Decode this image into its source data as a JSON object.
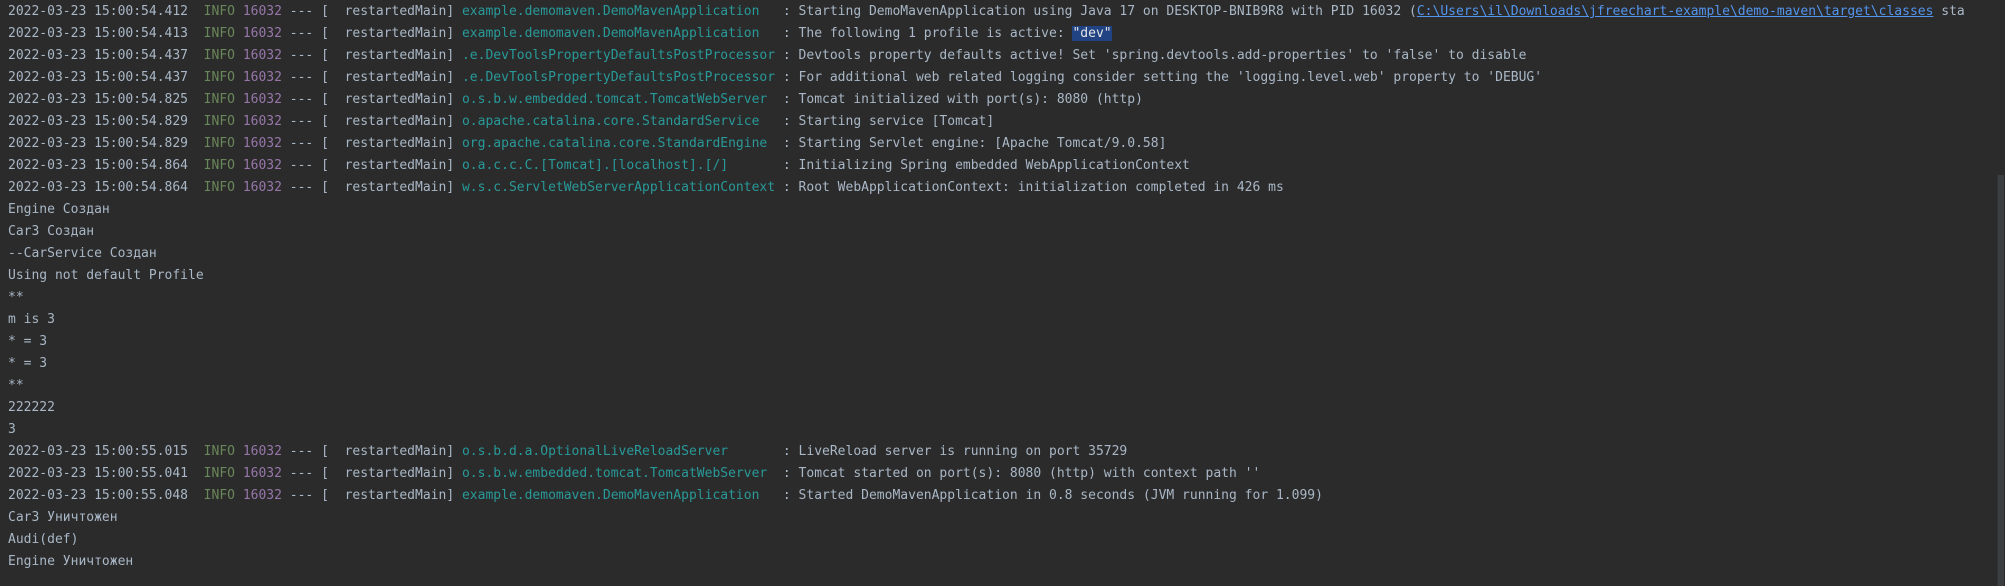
{
  "console": {
    "lines": [
      {
        "type": "log",
        "ts": "2022-03-23 15:00:54.412",
        "level": "INFO",
        "pid": "16032",
        "dashes": "---",
        "thread": "[  restartedMain]",
        "logger": "example.demomaven.DemoMavenApplication  ",
        "msg": ": Starting DemoMavenApplication using Java 17 on DESKTOP-BNIB9R8 with PID 16032 (",
        "link": "C:\\Users\\il\\Downloads\\jfreechart-example\\demo-maven\\target\\classes",
        "after": " sta"
      },
      {
        "type": "log",
        "ts": "2022-03-23 15:00:54.413",
        "level": "INFO",
        "pid": "16032",
        "dashes": "---",
        "thread": "[  restartedMain]",
        "logger": "example.demomaven.DemoMavenApplication  ",
        "msg": ": The following 1 profile is active: ",
        "highlight": "\"dev\""
      },
      {
        "type": "log",
        "ts": "2022-03-23 15:00:54.437",
        "level": "INFO",
        "pid": "16032",
        "dashes": "---",
        "thread": "[  restartedMain]",
        "logger": ".e.DevToolsPropertyDefaultsPostProcessor",
        "msg": ": Devtools property defaults active! Set 'spring.devtools.add-properties' to 'false' to disable"
      },
      {
        "type": "log",
        "ts": "2022-03-23 15:00:54.437",
        "level": "INFO",
        "pid": "16032",
        "dashes": "---",
        "thread": "[  restartedMain]",
        "logger": ".e.DevToolsPropertyDefaultsPostProcessor",
        "msg": ": For additional web related logging consider setting the 'logging.level.web' property to 'DEBUG'"
      },
      {
        "type": "log",
        "ts": "2022-03-23 15:00:54.825",
        "level": "INFO",
        "pid": "16032",
        "dashes": "---",
        "thread": "[  restartedMain]",
        "logger": "o.s.b.w.embedded.tomcat.TomcatWebServer ",
        "msg": ": Tomcat initialized with port(s): 8080 (http)"
      },
      {
        "type": "log",
        "ts": "2022-03-23 15:00:54.829",
        "level": "INFO",
        "pid": "16032",
        "dashes": "---",
        "thread": "[  restartedMain]",
        "logger": "o.apache.catalina.core.StandardService  ",
        "msg": ": Starting service [Tomcat]"
      },
      {
        "type": "log",
        "ts": "2022-03-23 15:00:54.829",
        "level": "INFO",
        "pid": "16032",
        "dashes": "---",
        "thread": "[  restartedMain]",
        "logger": "org.apache.catalina.core.StandardEngine ",
        "msg": ": Starting Servlet engine: [Apache Tomcat/9.0.58]"
      },
      {
        "type": "log",
        "ts": "2022-03-23 15:00:54.864",
        "level": "INFO",
        "pid": "16032",
        "dashes": "---",
        "thread": "[  restartedMain]",
        "logger": "o.a.c.c.C.[Tomcat].[localhost].[/]      ",
        "msg": ": Initializing Spring embedded WebApplicationContext"
      },
      {
        "type": "log",
        "ts": "2022-03-23 15:00:54.864",
        "level": "INFO",
        "pid": "16032",
        "dashes": "---",
        "thread": "[  restartedMain]",
        "logger": "w.s.c.ServletWebServerApplicationContext",
        "msg": ": Root WebApplicationContext: initialization completed in 426 ms"
      },
      {
        "type": "plain",
        "text": "Engine Создан"
      },
      {
        "type": "plain",
        "text": "Car3 Создан"
      },
      {
        "type": "plain",
        "text": "--CarService Создан"
      },
      {
        "type": "plain",
        "text": "Using not default Profile"
      },
      {
        "type": "plain",
        "text": "**"
      },
      {
        "type": "plain",
        "text": "m is 3"
      },
      {
        "type": "plain",
        "text": "* = 3"
      },
      {
        "type": "plain",
        "text": "* = 3"
      },
      {
        "type": "plain",
        "text": "**"
      },
      {
        "type": "plain",
        "text": "222222"
      },
      {
        "type": "plain",
        "text": "3"
      },
      {
        "type": "log",
        "ts": "2022-03-23 15:00:55.015",
        "level": "INFO",
        "pid": "16032",
        "dashes": "---",
        "thread": "[  restartedMain]",
        "logger": "o.s.b.d.a.OptionalLiveReloadServer      ",
        "msg": ": LiveReload server is running on port 35729"
      },
      {
        "type": "log",
        "ts": "2022-03-23 15:00:55.041",
        "level": "INFO",
        "pid": "16032",
        "dashes": "---",
        "thread": "[  restartedMain]",
        "logger": "o.s.b.w.embedded.tomcat.TomcatWebServer ",
        "msg": ": Tomcat started on port(s): 8080 (http) with context path ''"
      },
      {
        "type": "log",
        "ts": "2022-03-23 15:00:55.048",
        "level": "INFO",
        "pid": "16032",
        "dashes": "---",
        "thread": "[  restartedMain]",
        "logger": "example.demomaven.DemoMavenApplication  ",
        "msg": ": Started DemoMavenApplication in 0.8 seconds (JVM running for 1.099)"
      },
      {
        "type": "plain",
        "text": "Car3 Уничтожен"
      },
      {
        "type": "plain",
        "text": "Audi(def)"
      },
      {
        "type": "plain",
        "text": "Engine Уничтожен"
      }
    ]
  },
  "colors": {
    "background": "#2b2b2b",
    "text": "#a9b7c6",
    "level_info": "#6a8759",
    "pid": "#9876aa",
    "logger": "#299999",
    "link": "#5394ec",
    "selection": "#214283"
  },
  "icons": {
    "scrollbar": "vertical-scrollbar"
  }
}
